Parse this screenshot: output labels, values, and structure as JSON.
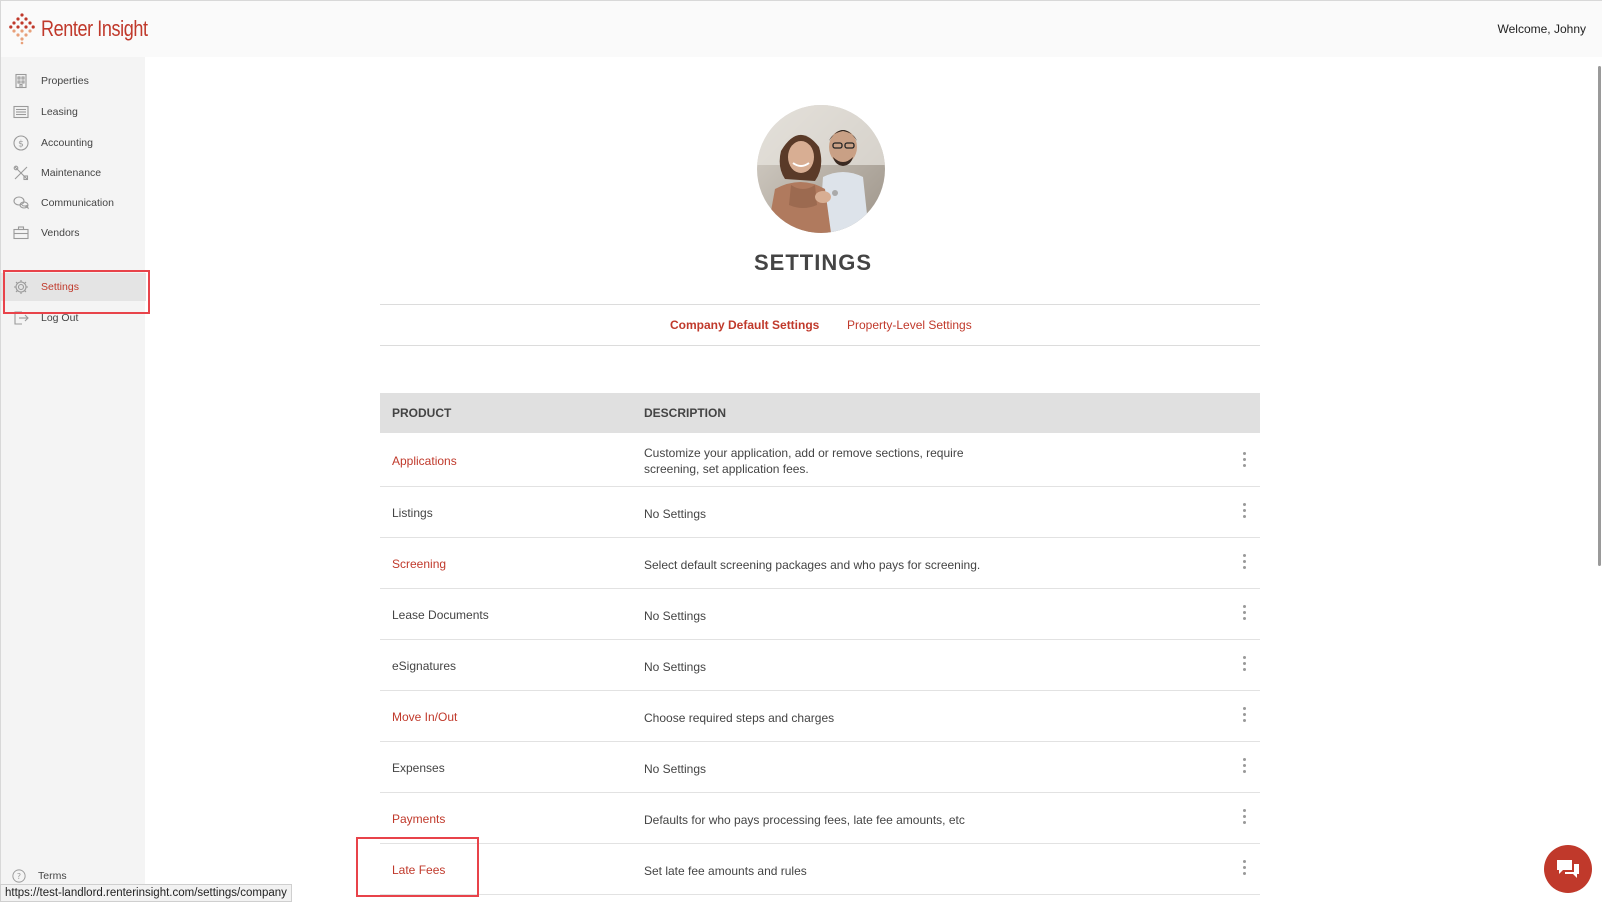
{
  "header": {
    "logo_text": "Renter Insight",
    "welcome": "Welcome, Johny"
  },
  "sidebar": {
    "items": [
      {
        "label": "Properties",
        "icon": "building-icon"
      },
      {
        "label": "Leasing",
        "icon": "list-icon"
      },
      {
        "label": "Accounting",
        "icon": "dollar-icon"
      },
      {
        "label": "Maintenance",
        "icon": "tools-icon"
      },
      {
        "label": "Communication",
        "icon": "chat-bubbles-icon"
      },
      {
        "label": "Vendors",
        "icon": "briefcase-icon"
      },
      {
        "label": "Settings",
        "icon": "gear-icon",
        "active": true
      },
      {
        "label": "Log Out",
        "icon": "logout-icon"
      }
    ],
    "terms": "Terms"
  },
  "page": {
    "title": "SETTINGS",
    "tabs": [
      {
        "label": "Company Default Settings",
        "active": true
      },
      {
        "label": "Property-Level Settings",
        "active": false
      }
    ]
  },
  "table": {
    "headers": [
      "PRODUCT",
      "DESCRIPTION"
    ],
    "rows": [
      {
        "product": "Applications",
        "link": true,
        "description": "Customize your application, add or remove sections, require screening, set application fees."
      },
      {
        "product": "Listings",
        "link": false,
        "description": "No Settings"
      },
      {
        "product": "Screening",
        "link": true,
        "description": "Select default screening packages and who pays for screening."
      },
      {
        "product": "Lease Documents",
        "link": false,
        "description": "No Settings"
      },
      {
        "product": "eSignatures",
        "link": false,
        "description": "No Settings"
      },
      {
        "product": "Move In/Out",
        "link": true,
        "description": "Choose required steps and charges"
      },
      {
        "product": "Expenses",
        "link": false,
        "description": "No Settings"
      },
      {
        "product": "Payments",
        "link": true,
        "description": "Defaults for who pays processing fees, late fee amounts, etc"
      },
      {
        "product": "Late Fees",
        "link": true,
        "description": "Set late fee amounts and rules"
      }
    ]
  },
  "status_bar": {
    "url": "https://test-landlord.renterinsight.com/settings/company"
  },
  "colors": {
    "brand": "#c0392b",
    "highlight": "#e8434a"
  }
}
